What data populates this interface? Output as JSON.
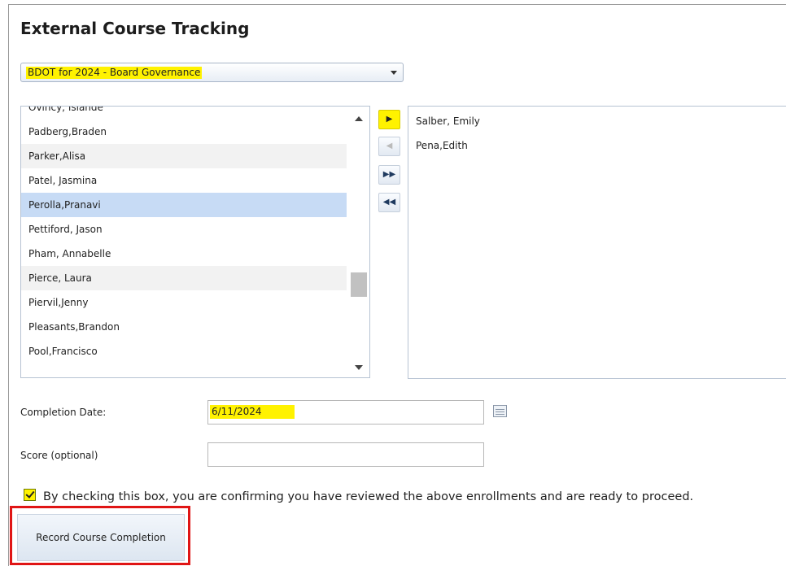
{
  "page": {
    "title": "External Course Tracking"
  },
  "course_select": {
    "selected": "BDOT for 2024 - Board Governance"
  },
  "available_list": {
    "items": [
      "Ovincy, Islande",
      "Padberg,Braden",
      "Parker,Alisa",
      "Patel, Jasmina",
      "Perolla,Pranavi",
      "Pettiford, Jason",
      "Pham, Annabelle",
      "Pierce, Laura",
      "Piervil,Jenny",
      "Pleasants,Brandon",
      "Pool,Francisco"
    ],
    "selected": "Perolla,Pranavi"
  },
  "move_buttons": {
    "move_right": "▶",
    "move_left": "◀",
    "move_all_right": "▶▶",
    "move_all_left": "◀◀"
  },
  "enrolled_list": {
    "items": [
      "Salber, Emily",
      "Pena,Edith"
    ]
  },
  "form": {
    "completion_date_label": "Completion Date:",
    "completion_date_value": "6/11/2024",
    "score_label": "Score (optional)",
    "score_value": "",
    "confirm_label": "By checking this box, you are confirming you have reviewed the above enrollments and are ready to proceed.",
    "confirm_checked": true
  },
  "actions": {
    "record_label": "Record Course Completion"
  },
  "icons": {
    "calendar": "calendar-icon",
    "dropdown": "chevron-down-icon"
  },
  "colors": {
    "highlight": "#fff200",
    "selection": "#c7dbf5",
    "outline": "#e01515"
  }
}
